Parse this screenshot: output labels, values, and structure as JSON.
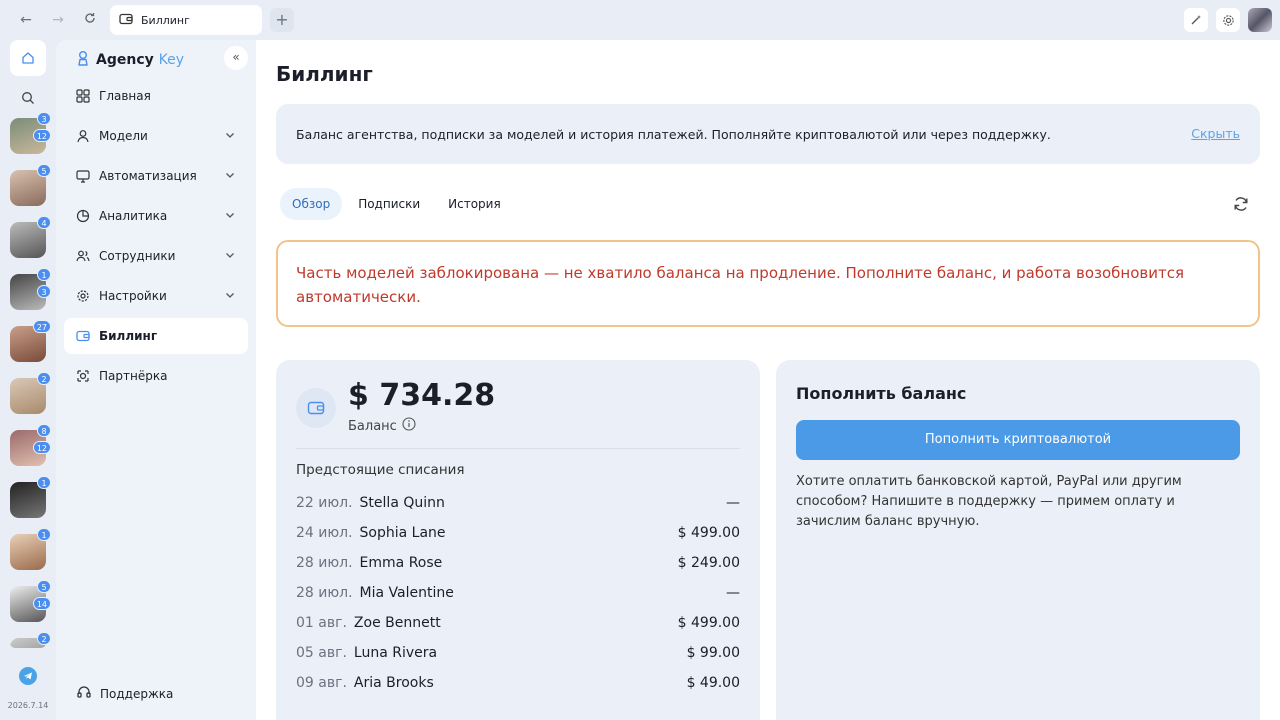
{
  "browser": {
    "tab_title": "Биллинг",
    "new_tab": "+"
  },
  "rail": {
    "models": [
      {
        "badges": [
          "3",
          "12"
        ],
        "colors": [
          "#7a8c7a",
          "#c9b89a"
        ]
      },
      {
        "badges": [
          "5"
        ],
        "colors": [
          "#d8c2b0",
          "#8a6a5a"
        ]
      },
      {
        "badges": [
          "4"
        ],
        "colors": [
          "#bbbbbb",
          "#555555"
        ]
      },
      {
        "badges": [
          "1",
          "3"
        ],
        "colors": [
          "#444444",
          "#bbbbbb"
        ]
      },
      {
        "badges": [
          "27"
        ],
        "colors": [
          "#c8a08a",
          "#7a4a3a"
        ]
      },
      {
        "badges": [
          "2"
        ],
        "colors": [
          "#d9c8b8",
          "#a88a6a"
        ]
      },
      {
        "badges": [
          "8",
          "12"
        ],
        "colors": [
          "#9a6a6a",
          "#e0c0b0"
        ]
      },
      {
        "badges": [
          "1"
        ],
        "colors": [
          "#222222",
          "#777777"
        ]
      },
      {
        "badges": [
          "1"
        ],
        "colors": [
          "#e8d0b8",
          "#9a6a4a"
        ]
      },
      {
        "badges": [
          "5",
          "14"
        ],
        "colors": [
          "#eeeeee",
          "#555555"
        ]
      },
      {
        "badges": [
          "2"
        ],
        "colors": [
          "#cccccc",
          "#777777"
        ]
      }
    ],
    "version": "2026.7.14"
  },
  "sidebar": {
    "logo_main": "Agency",
    "logo_accent": "Key",
    "items": [
      {
        "label": "Главная",
        "icon": "grid-icon",
        "chevron": false
      },
      {
        "label": "Модели",
        "icon": "user-icon",
        "chevron": true
      },
      {
        "label": "Автоматизация",
        "icon": "automation-icon",
        "chevron": true
      },
      {
        "label": "Аналитика",
        "icon": "analytics-icon",
        "chevron": true
      },
      {
        "label": "Сотрудники",
        "icon": "staff-icon",
        "chevron": true
      },
      {
        "label": "Настройки",
        "icon": "gear-icon",
        "chevron": true
      },
      {
        "label": "Биллинг",
        "icon": "wallet-icon",
        "chevron": false
      },
      {
        "label": "Партнёрка",
        "icon": "partner-icon",
        "chevron": false
      }
    ],
    "support": "Поддержка"
  },
  "main": {
    "title": "Биллинг",
    "info_text": "Баланс агентства, подписки за моделей и история платежей. Пополняйте криптовалютой или через поддержку.",
    "info_hide": "Скрыть",
    "tabs": [
      "Обзор",
      "Подписки",
      "История"
    ],
    "alert": "Часть моделей заблокирована — не хватило баланса на продление. Пополните баланс, и работа возобновится автоматически.",
    "balance": {
      "amount": "$ 734.28",
      "label": "Баланс",
      "upcoming_title": "Предстоящие списания",
      "charges": [
        {
          "date": "22 июл.",
          "name": "Stella Quinn",
          "amount": "—"
        },
        {
          "date": "24 июл.",
          "name": "Sophia Lane",
          "amount": "$ 499.00"
        },
        {
          "date": "28 июл.",
          "name": "Emma Rose",
          "amount": "$ 249.00"
        },
        {
          "date": "28 июл.",
          "name": "Mia Valentine",
          "amount": "—"
        },
        {
          "date": "01 авг.",
          "name": "Zoe Bennett",
          "amount": "$ 499.00"
        },
        {
          "date": "05 авг.",
          "name": "Luna Rivera",
          "amount": "$ 99.00"
        },
        {
          "date": "09 авг.",
          "name": "Aria Brooks",
          "amount": "$ 49.00"
        }
      ]
    },
    "topup": {
      "title": "Пополнить баланс",
      "crypto_button": "Пополнить криптовалютой",
      "note": "Хотите оплатить банковской картой, PayPal или другим способом? Напишите в поддержку — примем оплату и зачислим баланс вручную."
    }
  },
  "colors": {
    "accent": "#4a9ae8",
    "alert_border": "#f0c58c",
    "alert_text": "#c0392b",
    "badge": "#4a8ef0"
  }
}
